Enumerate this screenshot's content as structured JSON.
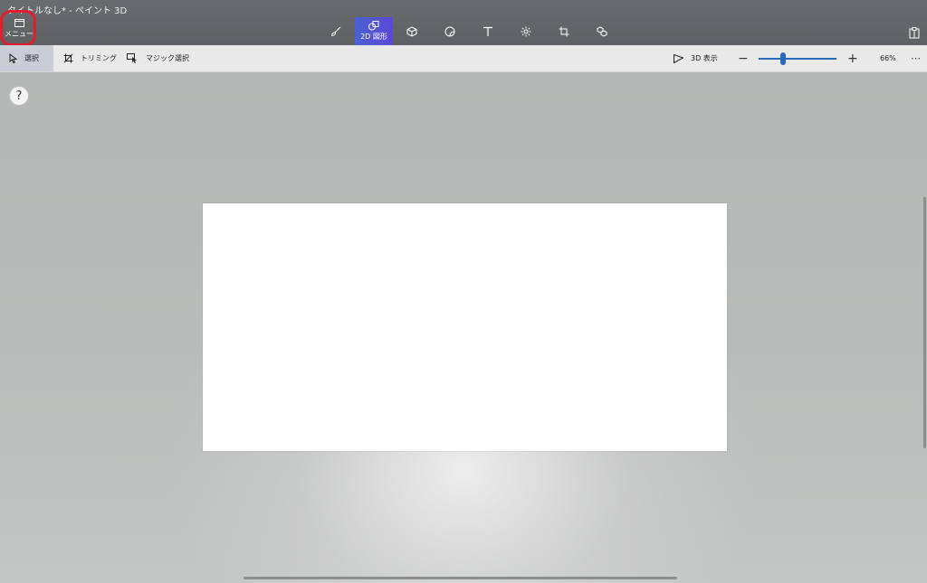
{
  "window": {
    "title": "タイトルなし* - ペイント 3D"
  },
  "menu": {
    "label": "メニュー"
  },
  "tools": [
    {
      "name": "brushes",
      "label": ""
    },
    {
      "name": "2d-shapes",
      "label": "2D 図形",
      "active": true
    },
    {
      "name": "3d-shapes",
      "label": ""
    },
    {
      "name": "stickers",
      "label": ""
    },
    {
      "name": "text",
      "label": ""
    },
    {
      "name": "effects",
      "label": ""
    },
    {
      "name": "canvas",
      "label": ""
    },
    {
      "name": "3d-library",
      "label": ""
    }
  ],
  "toolbar": {
    "select": "選択",
    "crop": "トリミング",
    "magic_select": "マジック選択",
    "view3d": "3D 表示",
    "zoom": "66%",
    "zoom_minus": "−",
    "zoom_plus": "+",
    "more": "⋯"
  },
  "zoom": {
    "percent": 66
  },
  "help": {
    "label": "?"
  },
  "colors": {
    "topbar": "#606165",
    "accent": "#4b61d1",
    "highlight": "#e31d2c",
    "slider": "#2a6bb8"
  }
}
